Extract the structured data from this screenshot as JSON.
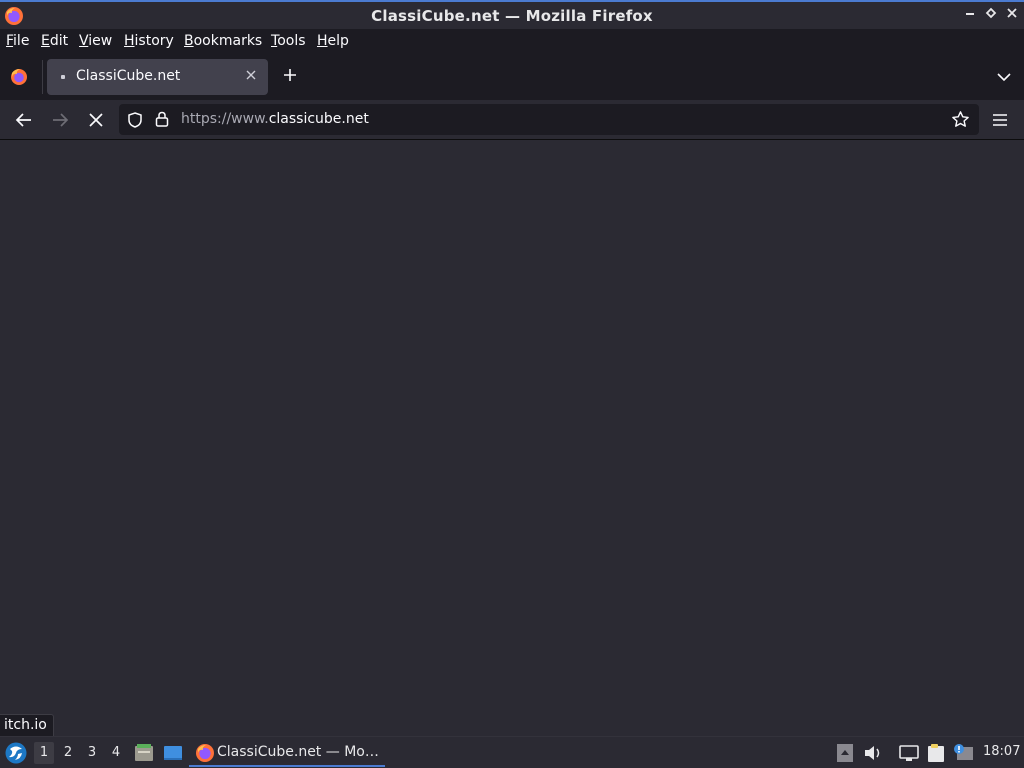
{
  "window": {
    "title": "ClassiCube.net — Mozilla Firefox",
    "icon": "firefox-icon",
    "controls": [
      "minimize-icon",
      "maximize-icon",
      "close-icon"
    ]
  },
  "menubar": {
    "items": [
      {
        "label": "File",
        "accel": "F",
        "rest": "ile"
      },
      {
        "label": "Edit",
        "accel": "E",
        "rest": "dit"
      },
      {
        "label": "View",
        "accel": "V",
        "rest": "iew"
      },
      {
        "label": "History",
        "accel": "H",
        "rest": "istory"
      },
      {
        "label": "Bookmarks",
        "accel": "B",
        "rest": "ookmarks"
      },
      {
        "label": "Tools",
        "accel": "T",
        "rest": "ools"
      },
      {
        "label": "Help",
        "accel": "H",
        "rest": "elp"
      }
    ]
  },
  "tabs": [
    {
      "title": "ClassiCube.net",
      "active": true,
      "loading": true
    }
  ],
  "navbar": {
    "url_prefix": "https://www.",
    "url_host": "classicube.net",
    "loading": true
  },
  "status": {
    "text": "itch.io"
  },
  "taskbar": {
    "workspaces": [
      "1",
      "2",
      "3",
      "4"
    ],
    "active_workspace": "1",
    "task_label": "ClassiCube.net — Mo…",
    "clock": "18:07"
  },
  "colors": {
    "accent": "#4b7bd1",
    "toolbar": "#2b2a33",
    "tabstrip": "#1c1b22"
  }
}
